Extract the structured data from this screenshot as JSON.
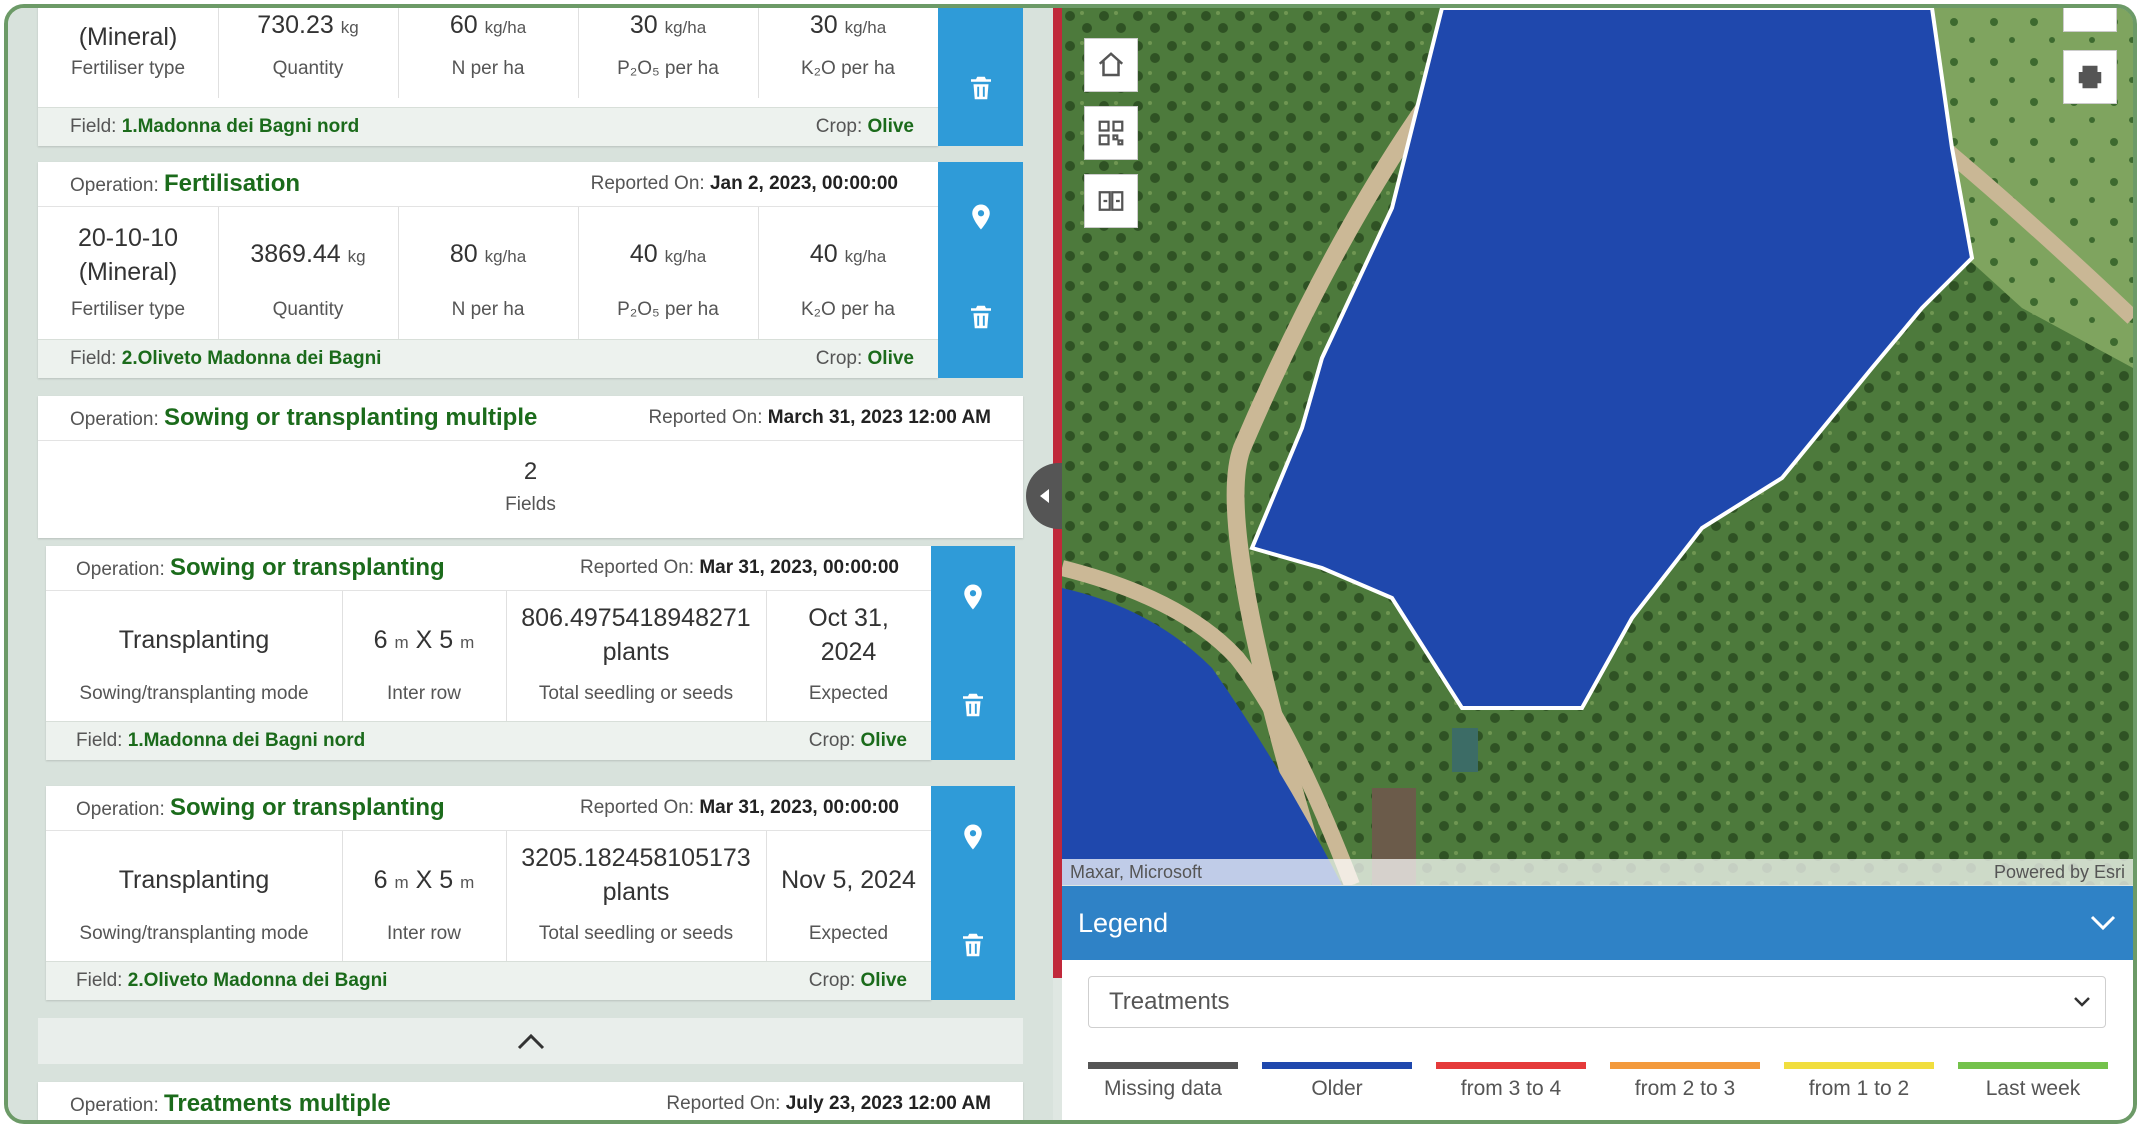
{
  "cards": [
    {
      "id": "fert-1",
      "fertiliser": "(Mineral)",
      "fertiliser_label": "Fertiliser type",
      "quantity": "730.23",
      "quantity_unit": "kg",
      "quantity_label": "Quantity",
      "n": "60",
      "n_unit": "kg/ha",
      "n_label": "N per ha",
      "p": "30",
      "p_unit": "kg/ha",
      "p_label": "P₂O₅ per ha",
      "k": "30",
      "k_unit": "kg/ha",
      "k_label": "K₂O per ha",
      "field_label": "Field:",
      "field": "1.Madonna dei Bagni nord",
      "crop_label": "Crop:",
      "crop": "Olive"
    },
    {
      "id": "fert-2",
      "op_label": "Operation:",
      "op": "Fertilisation",
      "reported_label": "Reported On:",
      "reported": "Jan 2, 2023, 00:00:00",
      "fertiliser": "20-10-10 (Mineral)",
      "fertiliser_label": "Fertiliser type",
      "quantity": "3869.44",
      "quantity_unit": "kg",
      "quantity_label": "Quantity",
      "n": "80",
      "n_unit": "kg/ha",
      "n_label": "N per ha",
      "p": "40",
      "p_unit": "kg/ha",
      "p_label": "P₂O₅ per ha",
      "k": "40",
      "k_unit": "kg/ha",
      "k_label": "K₂O per ha",
      "field_label": "Field:",
      "field": "2.Oliveto Madonna dei Bagni",
      "crop_label": "Crop:",
      "crop": "Olive"
    }
  ],
  "multi_sow": {
    "op_label": "Operation:",
    "op": "Sowing or transplanting multiple",
    "reported_label": "Reported On:",
    "reported": "March 31, 2023 12:00 AM",
    "count": "2",
    "count_label": "Fields"
  },
  "sow_cards": [
    {
      "op_label": "Operation:",
      "op": "Sowing or transplanting",
      "reported_label": "Reported On:",
      "reported": "Mar 31, 2023, 00:00:00",
      "mode": "Transplanting",
      "mode_label": "Sowing/transplanting mode",
      "row_a": "6",
      "row_unit_a": "m",
      "row_x": "X",
      "row_b": "5",
      "row_unit_b": "m",
      "row_label": "Inter row",
      "seeds": "806.4975418948271 plants",
      "seeds_label": "Total seedling or seeds",
      "expected": "Oct 31, 2024",
      "expected_label": "Expected",
      "field_label": "Field:",
      "field": "1.Madonna dei Bagni nord",
      "crop_label": "Crop:",
      "crop": "Olive"
    },
    {
      "op_label": "Operation:",
      "op": "Sowing or transplanting",
      "reported_label": "Reported On:",
      "reported": "Mar 31, 2023, 00:00:00",
      "mode": "Transplanting",
      "mode_label": "Sowing/transplanting mode",
      "row_a": "6",
      "row_unit_a": "m",
      "row_x": "X",
      "row_b": "5",
      "row_unit_b": "m",
      "row_label": "Inter row",
      "seeds": "3205.182458105173 plants",
      "seeds_label": "Total seedling or seeds",
      "expected": "Nov 5, 2024",
      "expected_label": "Expected",
      "field_label": "Field:",
      "field": "2.Oliveto Madonna dei Bagni",
      "crop_label": "Crop:",
      "crop": "Olive"
    }
  ],
  "treatments_multi": {
    "op_label": "Operation:",
    "op": "Treatments multiple",
    "reported_label": "Reported On:",
    "reported": "July 23, 2023 12:00 AM"
  },
  "map": {
    "attribution_left": "Maxar, Microsoft",
    "attribution_right": "Powered by Esri",
    "field_color": "#1f48ad"
  },
  "legend": {
    "title": "Legend",
    "select_value": "Treatments",
    "items": [
      {
        "label": "Missing data",
        "color": "#555555"
      },
      {
        "label": "Older",
        "color": "#1f48ad"
      },
      {
        "label": "from 3 to 4",
        "color": "#e53a3a"
      },
      {
        "label": "from 2 to 3",
        "color": "#f39a3c"
      },
      {
        "label": "from 1 to 2",
        "color": "#f1de3e"
      },
      {
        "label": "Last week",
        "color": "#74c24b"
      }
    ]
  },
  "colors": {
    "accent_blue": "#2f9bd8",
    "legend_blue": "#2f82c6",
    "value_green": "#1b6b1b",
    "divider_red": "#c0283a"
  }
}
